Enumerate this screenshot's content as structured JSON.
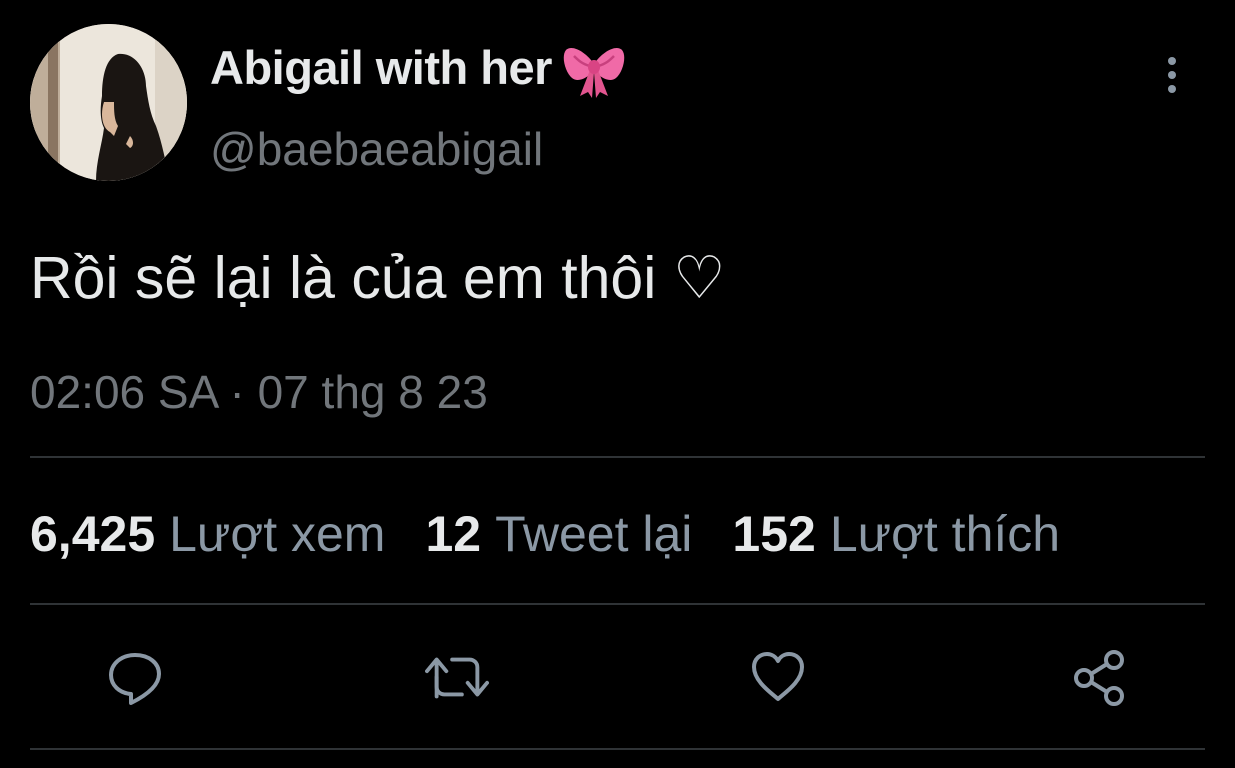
{
  "author": {
    "display_name": "Abigail with her",
    "bow_emoji": "🎀",
    "handle": "@baebaeabigail"
  },
  "tweet": {
    "text": "Rồi sẽ lại là của em thôi ♡",
    "timestamp": "02:06 SA · 07 thg 8 23"
  },
  "stats": {
    "views_count": "6,425",
    "views_label": "Lượt xem",
    "retweets_count": "12",
    "retweets_label": "Tweet lại",
    "likes_count": "152",
    "likes_label": "Lượt thích"
  },
  "icons": {
    "more": "more-vertical-icon",
    "reply": "reply-icon",
    "retweet": "retweet-icon",
    "like": "heart-icon",
    "share": "share-icon"
  },
  "colors": {
    "background": "#000000",
    "primary_text": "#e7e9ea",
    "secondary_text": "#71767b",
    "icon": "#8b98a5",
    "divider": "#2f3336",
    "bow": "#f06aa7"
  }
}
